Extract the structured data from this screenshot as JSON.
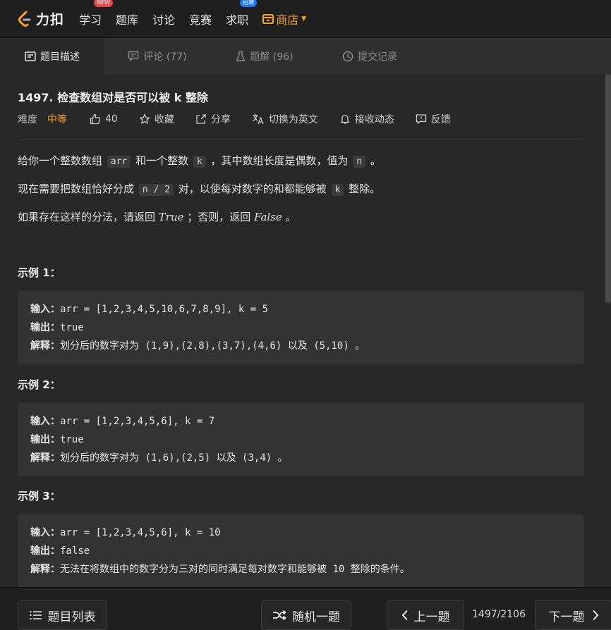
{
  "nav": {
    "logo_text": "力扣",
    "items": [
      {
        "label": "学习",
        "badge": "NEW"
      },
      {
        "label": "题库"
      },
      {
        "label": "讨论"
      },
      {
        "label": "竞赛"
      },
      {
        "label": "求职",
        "badge": "招聘"
      }
    ],
    "shop_label": "商店"
  },
  "tabs": [
    {
      "label": "题目描述",
      "active": true
    },
    {
      "label": "评论 (77)"
    },
    {
      "label": "题解 (96)"
    },
    {
      "label": "提交记录"
    }
  ],
  "problem": {
    "title": "1497. 检查数组对是否可以被 k 整除",
    "difficulty_label": "难度",
    "difficulty": "中等",
    "likes": "40",
    "actions": {
      "favorite": "收藏",
      "share": "分享",
      "switch_lang": "切换为英文",
      "subscribe": "接收动态",
      "feedback": "反馈"
    },
    "desc": {
      "p1_a": "给你一个整数数组",
      "p1_code1": "arr",
      "p1_b": "和一个整数",
      "p1_code2": "k",
      "p1_c": "，其中数组长度是偶数，值为",
      "p1_code3": "n",
      "p1_d": "。",
      "p2_a": "现在需要把数组恰好分成",
      "p2_code1": "n / 2",
      "p2_b": "对，以使每对数字的和都能够被",
      "p2_code2": "k",
      "p2_c": "整除。",
      "p3_a": "如果存在这样的分法，请返回",
      "p3_true": "True",
      "p3_b": "；否则，返回",
      "p3_false": "False",
      "p3_c": "。"
    },
    "examples": [
      {
        "title": "示例 1：",
        "input_label": "输入：",
        "input": "arr = [1,2,3,4,5,10,6,7,8,9], k = 5",
        "output_label": "输出：",
        "output": "true",
        "explain_label": "解释：",
        "explain_a": "划分后的数字对为",
        "explain_code": "(1,9),(2,8),(3,7),(4,6)",
        "explain_b": "以及",
        "explain_code2": "(5,10)",
        "explain_c": "。"
      },
      {
        "title": "示例 2：",
        "input_label": "输入：",
        "input": "arr = [1,2,3,4,5,6], k = 7",
        "output_label": "输出：",
        "output": "true",
        "explain_label": "解释：",
        "explain_a": "划分后的数字对为",
        "explain_code": "(1,6),(2,5)",
        "explain_b": "以及",
        "explain_code2": "(3,4)",
        "explain_c": "。"
      },
      {
        "title": "示例 3：",
        "input_label": "输入：",
        "input": "arr = [1,2,3,4,5,6], k = 10",
        "output_label": "输出：",
        "output": "false",
        "explain_label": "解释：",
        "explain_a": "无法在将数组中的数字分为三对的同时满足每对数字和能够被",
        "explain_code": "10",
        "explain_b": "整除的条件。"
      }
    ]
  },
  "bottom": {
    "list_label": "题目列表",
    "random_label": "随机一题",
    "prev_label": "上一题",
    "counter": "1497/2106",
    "next_label": "下一题"
  },
  "colors": {
    "accent_orange": "#ff9f1a",
    "shop": "#f5a623",
    "badge_new": "#e5484d",
    "badge_hire": "#1677ff"
  }
}
